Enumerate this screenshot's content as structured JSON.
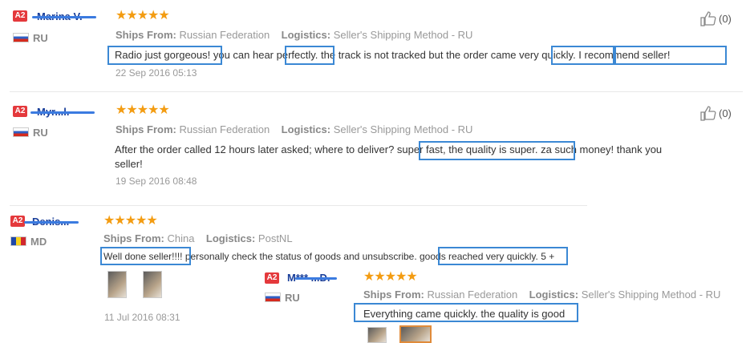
{
  "reviews": [
    {
      "badge": "A2",
      "name": "Marina V.",
      "country": "RU",
      "stars": "★★★★★",
      "ships_label": "Ships From:",
      "ships_value": "Russian Federation",
      "logistics_label": "Logistics:",
      "logistics_value": "Seller's Shipping Method - RU",
      "text": "Radio just gorgeous! you can hear perfectly. the track is not tracked but the order came very quickly. I recommend seller!",
      "date": "22 Sep 2016 05:13",
      "likes": "(0)"
    },
    {
      "badge": "A2",
      "name": "Myr...l.",
      "country": "RU",
      "stars": "★★★★★",
      "ships_label": "Ships From:",
      "ships_value": "Russian Federation",
      "logistics_label": "Logistics:",
      "logistics_value": "Seller's Shipping Method - RU",
      "text_line1": "After the order called 12 hours later asked; where to deliver? super fast, the quality is super. za such money! thank you",
      "text_line2": "seller!",
      "date": "19 Sep 2016 08:48",
      "likes": "(0)"
    },
    {
      "badge": "A2",
      "name": "Denis...",
      "country": "MD",
      "stars": "★★★★★",
      "ships_label": "Ships From:",
      "ships_value": "China",
      "logistics_label": "Logistics:",
      "logistics_value": "PostNL",
      "text": "Well done seller!!!! personally check the status of goods and unsubscribe. goods reached very quickly. 5 +",
      "date": "11 Jul 2016 08:31"
    },
    {
      "badge": "A2",
      "name": "M*** ...D.",
      "country": "RU",
      "stars": "★★★★★",
      "ships_label": "Ships From:",
      "ships_value": "Russian Federation",
      "logistics_label": "Logistics:",
      "logistics_value": "Seller's Shipping Method - RU",
      "text": "Everything came quickly. the quality is good"
    }
  ],
  "icons": {
    "like": "thumbs-up-icon",
    "flag_ru": "flag-ru-icon",
    "flag_md": "flag-md-icon"
  },
  "colors": {
    "highlight": "#3b88d4",
    "stars": "#f39c12",
    "badge": "#e4393c"
  }
}
